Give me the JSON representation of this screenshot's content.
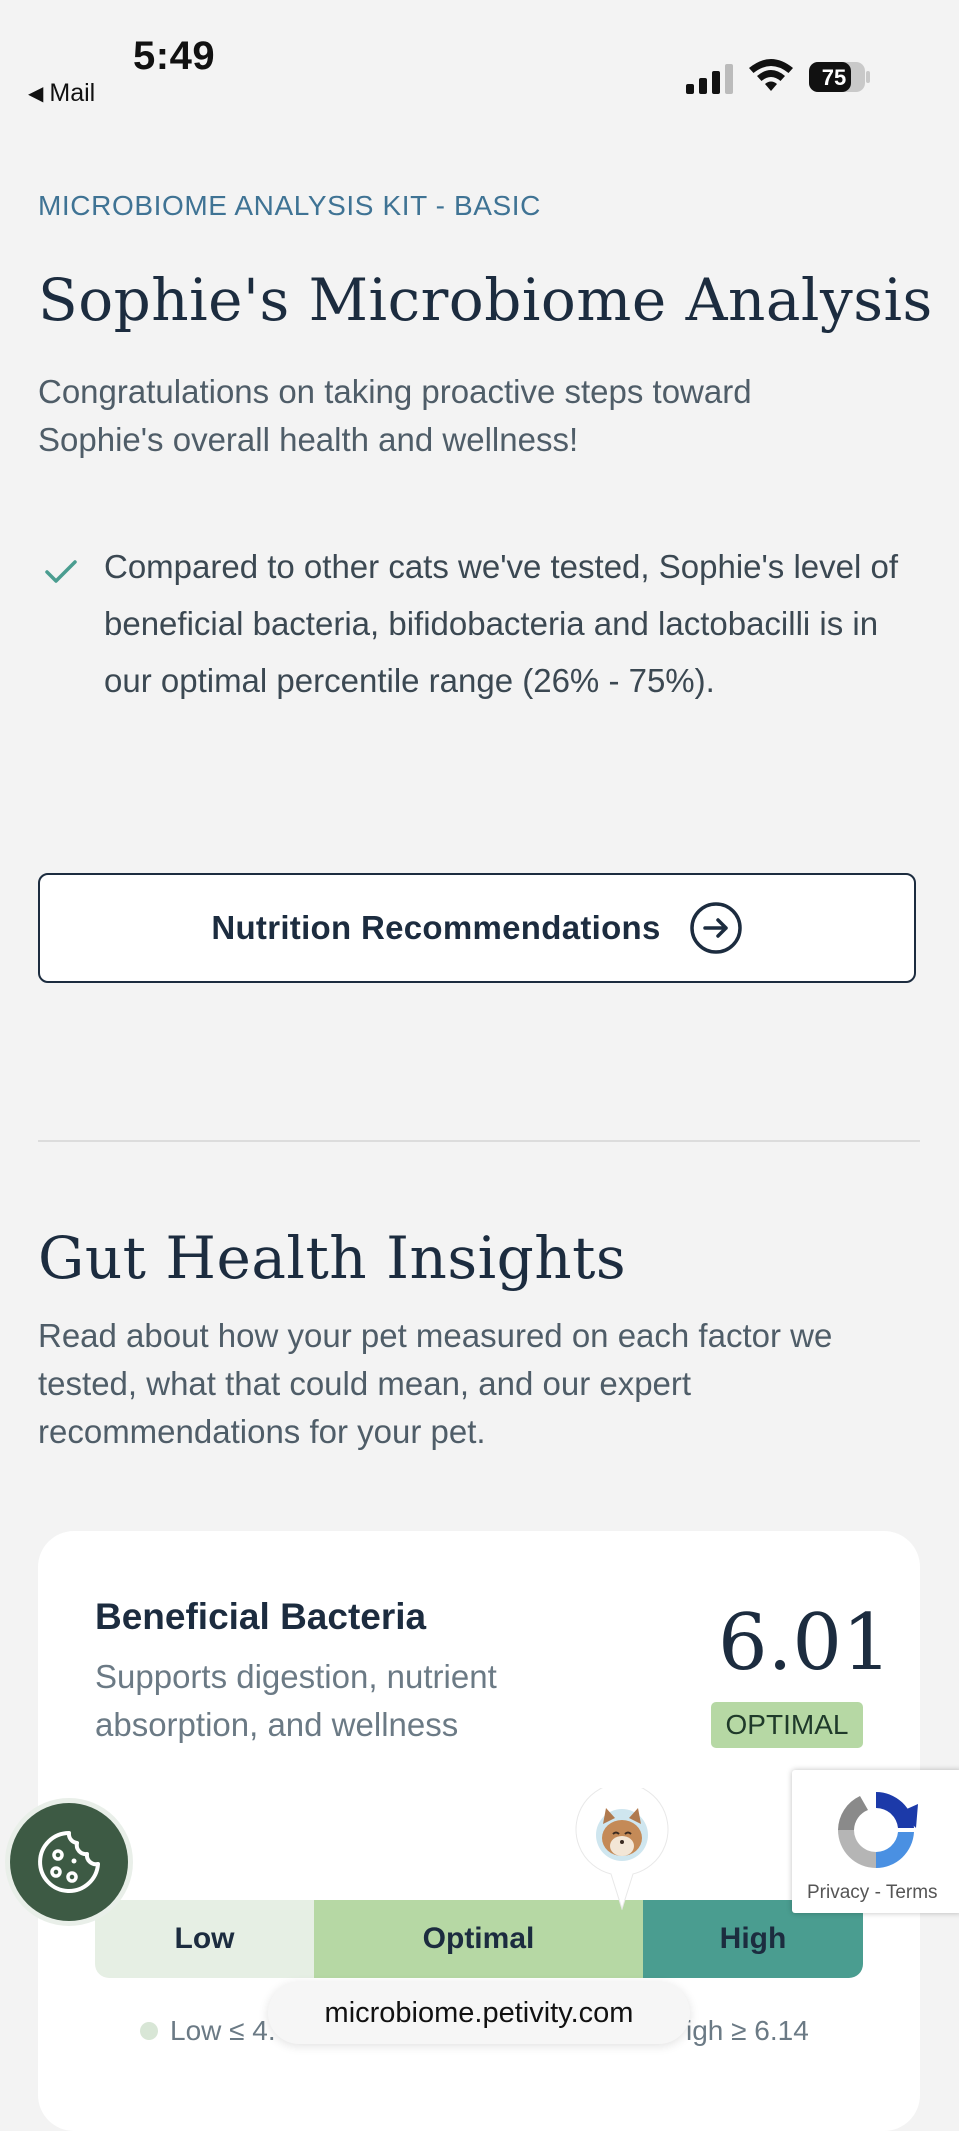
{
  "status_bar": {
    "time": "5:49",
    "back_label": "Mail",
    "battery": "75"
  },
  "header": {
    "kit_label": "MICROBIOME ANALYSIS KIT - BASIC",
    "title": "Sophie's Microbiome Analysis",
    "subtitle": "Congratulations on taking proactive steps toward Sophie's overall health and wellness!"
  },
  "highlights": [
    {
      "icon": "check-icon",
      "text": "Compared to other cats we've tested, Sophie's level of beneficial bacteria, bifidobacteria and lactobacilli is in our optimal percentile range (26% - 75%)."
    }
  ],
  "cta": {
    "label": "Nutrition Recommendations",
    "icon": "arrow-right-circle-icon"
  },
  "gut_health": {
    "title": "Gut Health Insights",
    "description": "Read about how your pet measured on each factor we tested, what that could mean, and our expert recommendations for your pet."
  },
  "beneficial_bacteria": {
    "title": "Beneficial Bacteria",
    "description": "Supports digestion, nutrient absorption, and wellness",
    "value": "6.01",
    "status": "OPTIMAL",
    "scale": {
      "low": "Low",
      "optimal": "Optimal",
      "high": "High"
    },
    "legend_low": "Low ≤ 4.",
    "legend_high": "igh ≥ 6.14"
  },
  "browser": {
    "url": "microbiome.petivity.com"
  },
  "recaptcha": {
    "terms": "Privacy - Terms"
  },
  "colors": {
    "background": "#f3f3f3",
    "navy": "#1c2c3f",
    "kit_blue": "#3f7394",
    "check_green": "#4a9d90",
    "optimal_green": "#b6d8a4",
    "high_teal": "#4a9d90",
    "low_green": "#e6efe4",
    "cookie_green": "#3d5a44"
  }
}
